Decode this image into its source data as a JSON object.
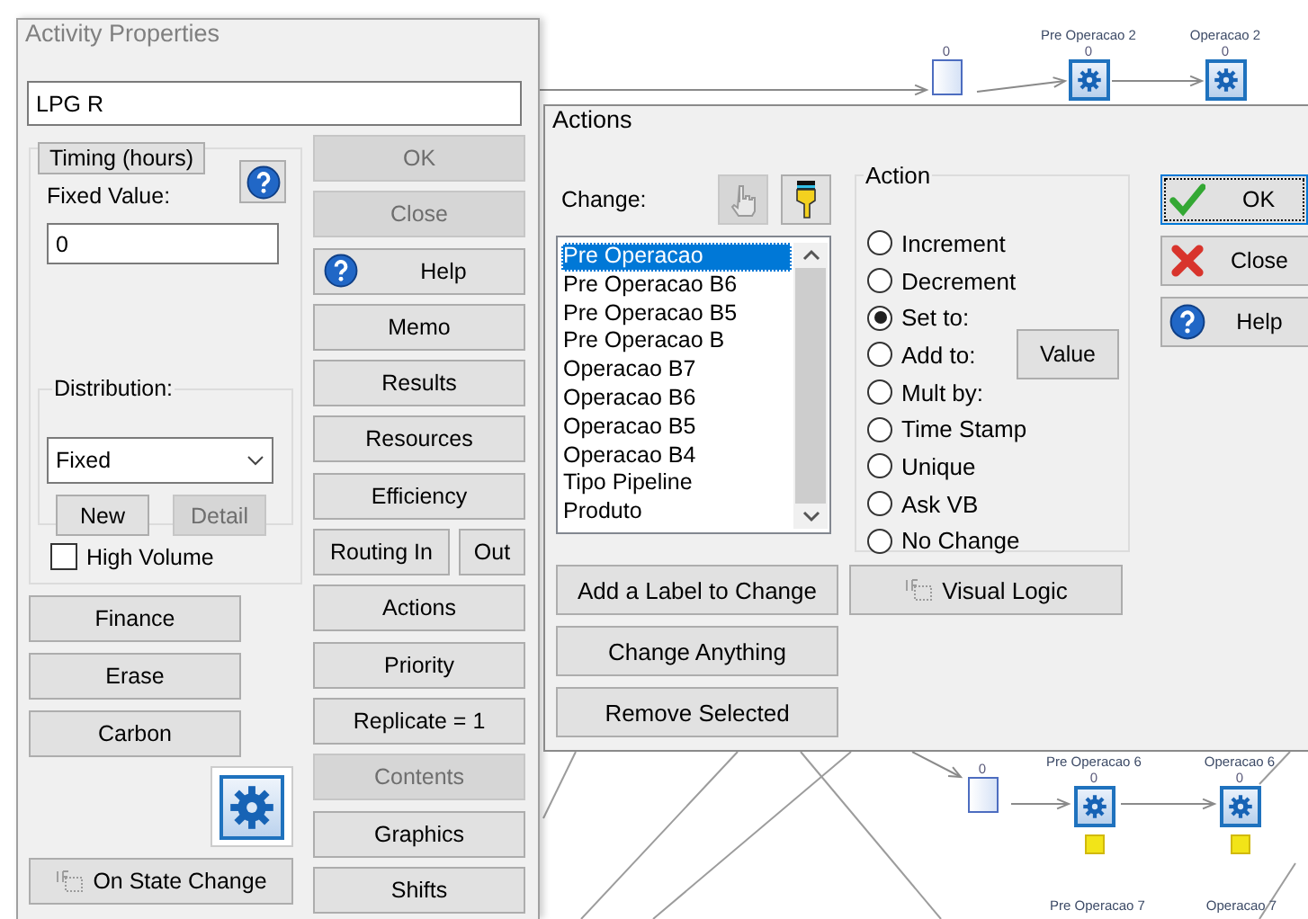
{
  "activity_properties": {
    "title": "Activity Properties",
    "name": "LPG R",
    "timing_tab": "Timing (hours)",
    "fixed_value_label": "Fixed Value:",
    "fixed_value": "0",
    "distribution_label": "Distribution:",
    "distribution": "Fixed",
    "distribution_buttons": [
      {
        "label": "New",
        "disabled": false
      },
      {
        "label": "Detail",
        "disabled": true
      }
    ],
    "high_volume": {
      "label": "High Volume",
      "checked": false
    },
    "left_buttons": [
      {
        "label": "Finance"
      },
      {
        "label": "Erase"
      },
      {
        "label": "Carbon"
      }
    ],
    "state_change_button": "On State Change",
    "side_buttons": [
      [
        {
          "kind": "plain",
          "label": "OK",
          "disabled": true
        }
      ],
      [
        {
          "kind": "plain",
          "label": "Close",
          "disabled": true
        }
      ],
      [
        {
          "kind": "help",
          "label": "Help",
          "disabled": false
        }
      ],
      [
        {
          "kind": "plain",
          "label": "Memo",
          "disabled": false
        }
      ],
      [
        {
          "kind": "plain",
          "label": "Results",
          "disabled": false
        }
      ],
      [
        {
          "kind": "plain",
          "label": "Resources",
          "disabled": false
        }
      ],
      [
        {
          "kind": "plain",
          "label": "Efficiency",
          "disabled": false
        }
      ],
      [
        {
          "kind": "plain",
          "label": "Routing In",
          "disabled": false
        },
        {
          "kind": "plain",
          "label": "Out",
          "disabled": false
        }
      ],
      [
        {
          "kind": "plain",
          "label": "Actions",
          "disabled": false
        }
      ],
      [
        {
          "kind": "plain",
          "label": "Priority",
          "disabled": false
        }
      ],
      [
        {
          "kind": "plain",
          "label": "Replicate = 1",
          "disabled": false
        }
      ],
      [
        {
          "kind": "plain",
          "label": "Contents",
          "disabled": true
        }
      ],
      [
        {
          "kind": "plain",
          "label": "Graphics",
          "disabled": false
        }
      ],
      [
        {
          "kind": "plain",
          "label": "Shifts",
          "disabled": false
        }
      ]
    ]
  },
  "actions": {
    "title": "Actions",
    "change_label": "Change:",
    "change_tools": [
      {
        "kind": "hand",
        "disabled": true
      },
      {
        "kind": "pointer",
        "disabled": false
      }
    ],
    "items": [
      {
        "text": "Pre Operacao",
        "selected": true
      },
      {
        "text": "Pre Operacao B6",
        "selected": false
      },
      {
        "text": "Pre Operacao B5",
        "selected": false
      },
      {
        "text": "Pre Operacao B",
        "selected": false
      },
      {
        "text": "Operacao B7",
        "selected": false
      },
      {
        "text": "Operacao B6",
        "selected": false
      },
      {
        "text": "Operacao B5",
        "selected": false
      },
      {
        "text": "Operacao B4",
        "selected": false
      },
      {
        "text": "Tipo Pipeline",
        "selected": false
      },
      {
        "text": "Produto",
        "selected": false
      }
    ],
    "action": {
      "legend": "Action",
      "options": [
        {
          "label": "Increment",
          "selected": false
        },
        {
          "label": "Decrement",
          "selected": false
        },
        {
          "label": "Set to:",
          "selected": true
        },
        {
          "label": "Add to:",
          "selected": false,
          "button": "Value"
        },
        {
          "label": "Mult by:",
          "selected": false
        },
        {
          "label": "Time Stamp",
          "selected": false
        },
        {
          "label": "Unique",
          "selected": false
        },
        {
          "label": "Ask VB",
          "selected": false
        },
        {
          "label": "No Change",
          "selected": false
        }
      ]
    },
    "dialog_buttons": [
      {
        "kind": "check",
        "label": "OK",
        "focused": true
      },
      {
        "kind": "cross",
        "label": "Close",
        "focused": false
      },
      {
        "kind": "help",
        "label": "Help",
        "focused": false
      }
    ],
    "bottom_buttons": [
      [
        {
          "kind": "plain",
          "label": "Add a Label to Change"
        },
        {
          "kind": "logic",
          "label": "Visual Logic"
        }
      ],
      [
        {
          "kind": "plain",
          "label": "Change Anything"
        }
      ],
      [
        {
          "kind": "plain",
          "label": "Remove Selected"
        }
      ]
    ]
  },
  "diagram": {
    "nodes": [
      {
        "kind": "queue",
        "count": "0"
      },
      {
        "kind": "activity",
        "label": "Pre Operacao 2",
        "count": "0"
      },
      {
        "kind": "activity",
        "label": "Operacao 2",
        "count": "0"
      },
      {
        "kind": "queue",
        "count": "0"
      },
      {
        "kind": "activity",
        "label": "Pre Operacao 6",
        "count": "0",
        "flag": true
      },
      {
        "kind": "activity",
        "label": "Operacao 6",
        "count": "0",
        "flag": true
      },
      {
        "kind": "label",
        "label": "Pre Operacao 7"
      },
      {
        "kind": "label",
        "label": "Operacao 7"
      }
    ]
  }
}
